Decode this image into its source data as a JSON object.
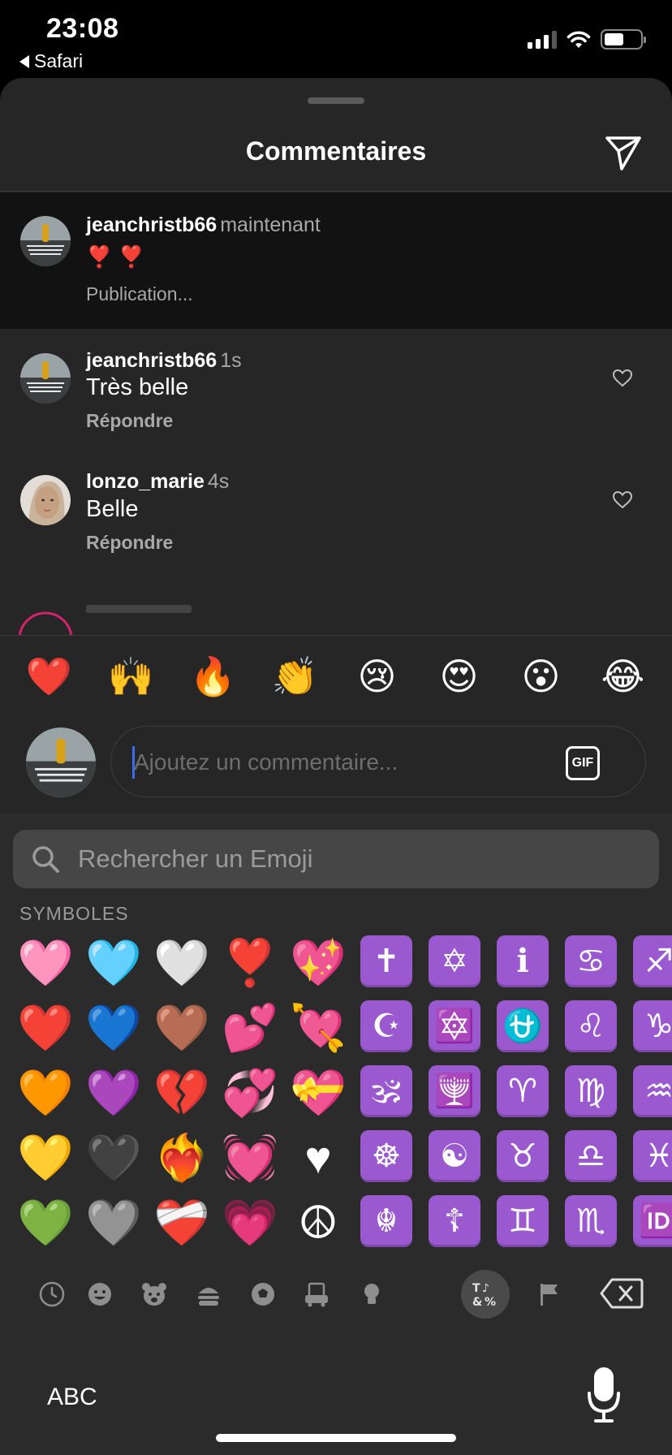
{
  "status_bar": {
    "time": "23:08",
    "back_app": "Safari"
  },
  "sheet": {
    "title": "Commentaires"
  },
  "caption": {
    "username": "jeanchristb66",
    "meta": "maintenant",
    "text": "❣️ ❣️",
    "subtext": "Publication..."
  },
  "comments": [
    {
      "username": "jeanchristb66",
      "meta": "1s",
      "text": "Très belle",
      "reply": "Répondre"
    },
    {
      "username": "lonzo_marie",
      "meta": "4s",
      "text": "Belle",
      "reply": "Répondre"
    }
  ],
  "reactions": [
    "❤️",
    "🙌",
    "🔥",
    "👏",
    "😢",
    "😍",
    "😮",
    "😂"
  ],
  "composer": {
    "placeholder": "Ajoutez un commentaire...",
    "gif_label": "GIF"
  },
  "keyboard": {
    "search_placeholder": "Rechercher un Emoji",
    "section_label": "SYMBOLES",
    "abc_label": "ABC",
    "active_category_label": "Symbols",
    "rows": [
      [
        "🩷",
        "🩵",
        "🤍",
        "❣️",
        "💖",
        "✝",
        "✡",
        "ℹ",
        "♋",
        "♐"
      ],
      [
        "❤️",
        "💙",
        "🤎",
        "💕",
        "💘",
        "☪",
        "🔯",
        "⛎",
        "♌",
        "♑"
      ],
      [
        "🧡",
        "💜",
        "💔",
        "💞",
        "💝",
        "🕉",
        "🕎",
        "♈",
        "♍",
        "♒"
      ],
      [
        "💛",
        "🖤",
        "❤️‍🔥",
        "💓",
        "♥",
        "☸",
        "☯",
        "♉",
        "♎",
        "♓"
      ],
      [
        "💚",
        "🩶",
        "❤️‍🩹",
        "💗",
        "☮",
        "☬",
        "☦",
        "♊",
        "♏",
        "🆔"
      ]
    ],
    "symbol_columns_start": 5
  },
  "colors": {
    "sheet_bg": "#262626",
    "caption_bg": "#121212",
    "keyboard_bg": "#2b2b2b",
    "symbol_tile": "#9b59d0",
    "caret": "#3a6df0"
  }
}
